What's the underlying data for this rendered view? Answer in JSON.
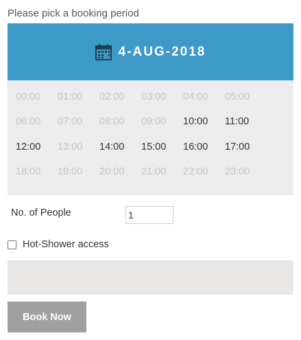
{
  "prompt": "Please pick a booking period",
  "calendar": {
    "date_label": "4-AUG-2018",
    "icon": "calendar-icon",
    "header_color": "#3d9ac6"
  },
  "slots": [
    {
      "time": "00:00",
      "available": false
    },
    {
      "time": "01:00",
      "available": false
    },
    {
      "time": "02:00",
      "available": false
    },
    {
      "time": "03:00",
      "available": false
    },
    {
      "time": "04:00",
      "available": false
    },
    {
      "time": "05:00",
      "available": false
    },
    {
      "time": "06:00",
      "available": false
    },
    {
      "time": "07:00",
      "available": false
    },
    {
      "time": "08:00",
      "available": false
    },
    {
      "time": "09:00",
      "available": false
    },
    {
      "time": "10:00",
      "available": true
    },
    {
      "time": "11:00",
      "available": true
    },
    {
      "time": "12:00",
      "available": true
    },
    {
      "time": "13:00",
      "available": false
    },
    {
      "time": "14:00",
      "available": true
    },
    {
      "time": "15:00",
      "available": true
    },
    {
      "time": "16:00",
      "available": true
    },
    {
      "time": "17:00",
      "available": true
    },
    {
      "time": "18:00",
      "available": false
    },
    {
      "time": "19:00",
      "available": false
    },
    {
      "time": "20:00",
      "available": false
    },
    {
      "time": "21:00",
      "available": false
    },
    {
      "time": "22:00",
      "available": false
    },
    {
      "time": "23:00",
      "available": false
    }
  ],
  "form": {
    "people_label": "No. of People",
    "people_value": "1",
    "shower_label": "Hot-Shower access",
    "shower_checked": false
  },
  "book_button": {
    "label": "Book Now",
    "color": "#a0a0a0"
  }
}
